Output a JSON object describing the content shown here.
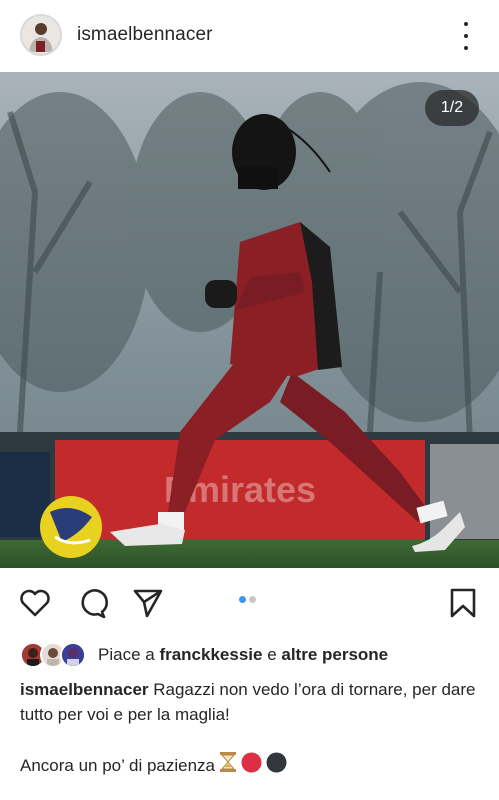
{
  "post": {
    "username": "ismaelbennacer",
    "image_counter": "1/2",
    "carousel": {
      "total": 2,
      "active": 1
    }
  },
  "likes": {
    "prefix": "Piace a ",
    "first_user": "franckkessie",
    "connector": " e ",
    "others": "altre persone"
  },
  "caption": {
    "username": "ismaelbennacer",
    "text": " Ragazzi non vedo l’ora di tornare, per dare tutto per voi e per la maglia!",
    "line2": "Ancora un po’ di pazienza"
  },
  "icons": {
    "like": "heart-icon",
    "comment": "comment-icon",
    "share": "paper-plane-icon",
    "save": "bookmark-icon",
    "more": "more-options-icon"
  },
  "colors": {
    "text": "#262626",
    "carousel_active": "#3897f0",
    "carousel_inactive": "#c7c7c7",
    "kit_red": "#8a1f26"
  }
}
